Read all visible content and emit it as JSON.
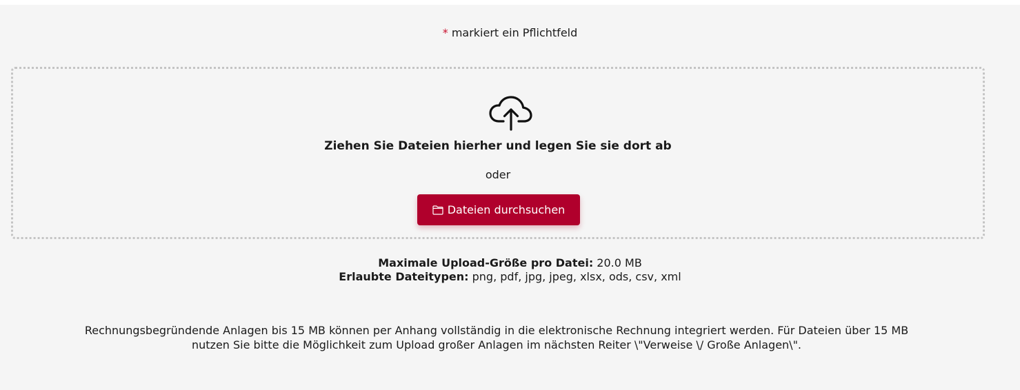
{
  "required_note": {
    "star": "*",
    "text": " markiert ein Pflichtfeld"
  },
  "dropzone": {
    "icon": "cloud-upload-icon",
    "title": "Ziehen Sie Dateien hierher und legen Sie sie dort ab",
    "or_text": "oder",
    "browse_button": {
      "icon": "folder-icon",
      "label": "Dateien durchsuchen"
    }
  },
  "limits": {
    "max_size_label": "Maximale Upload-Größe pro Datei:",
    "max_size_value": " 20.0 MB",
    "file_types_label": "Erlaubte Dateitypen:",
    "file_types_value": " png, pdf, jpg, jpeg, xlsx, ods, csv, xml"
  },
  "info": {
    "text": "Rechnungsbegründende Anlagen bis 15 MB können per Anhang vollständig in die elektronische Rechnung integriert werden. Für Dateien über 15 MB nutzen Sie bitte die Möglichkeit zum Upload großer Anlagen im nächsten Reiter \\\"Verweise \\/ Große Anlagen\\\"."
  },
  "colors": {
    "accent": "#b0002c",
    "required_star": "#c8102e",
    "panel_background": "#f5f5f5",
    "dropzone_border": "#c4c4c4"
  }
}
